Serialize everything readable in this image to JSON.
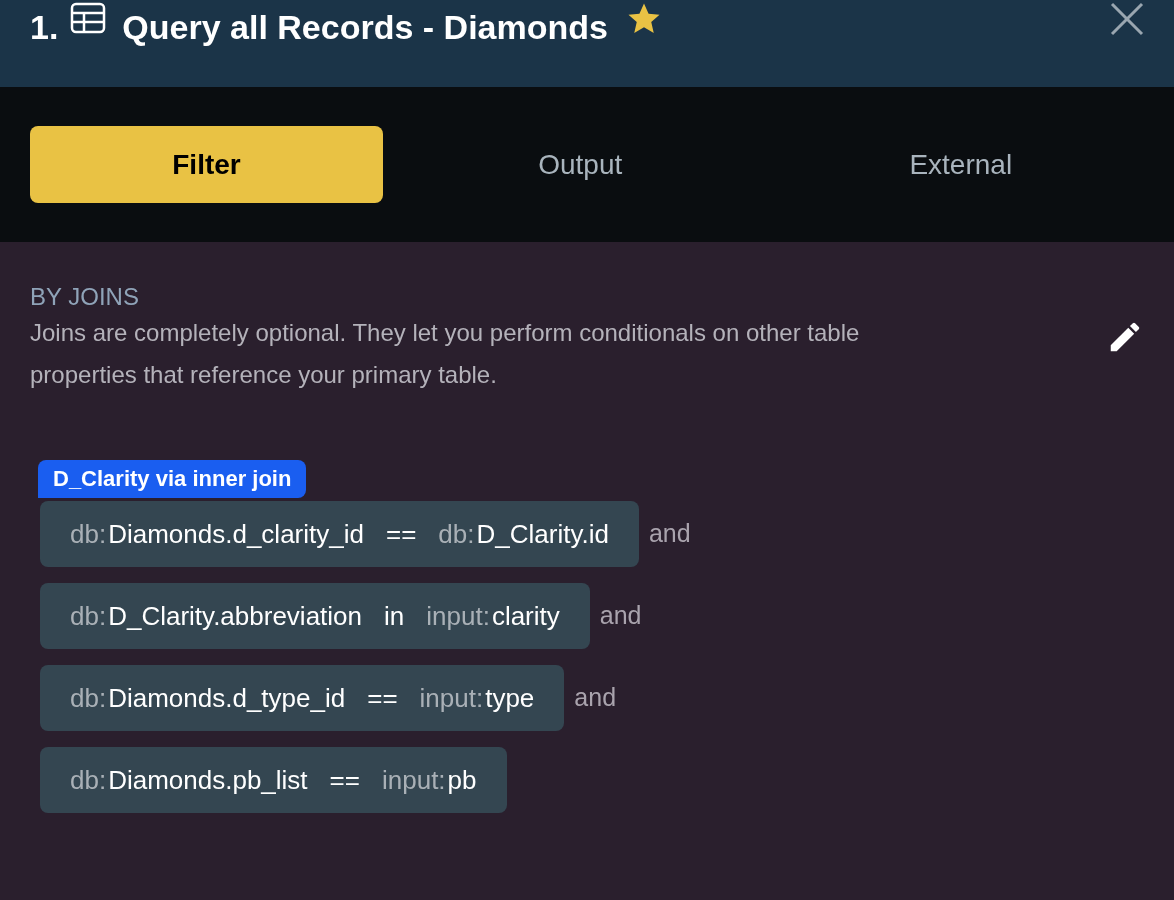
{
  "header": {
    "number": "1.",
    "title": "Query all Records - Diamonds",
    "starred": true
  },
  "tabs": [
    {
      "label": "Filter",
      "selected": true
    },
    {
      "label": "Output",
      "selected": false
    },
    {
      "label": "External",
      "selected": false
    }
  ],
  "section": {
    "heading": "BY JOINS",
    "description": "Joins are completely optional. They let you perform conditionals on other table properties that reference your primary table."
  },
  "join": {
    "badge": "D_Clarity via inner join",
    "conditions": [
      {
        "left_prefix": "db:",
        "left": "Diamonds.d_clarity_id",
        "operator": "==",
        "right_prefix": "db:",
        "right": "D_Clarity.id",
        "connector": "and"
      },
      {
        "left_prefix": "db:",
        "left": "D_Clarity.abbreviation",
        "operator": "in",
        "right_prefix": "input:",
        "right": "clarity",
        "connector": "and"
      },
      {
        "left_prefix": "db:",
        "left": "Diamonds.d_type_id",
        "operator": "==",
        "right_prefix": "input:",
        "right": "type",
        "connector": "and"
      },
      {
        "left_prefix": "db:",
        "left": "Diamonds.pb_list",
        "operator": "==",
        "right_prefix": "input:",
        "right": "pb"
      }
    ]
  }
}
